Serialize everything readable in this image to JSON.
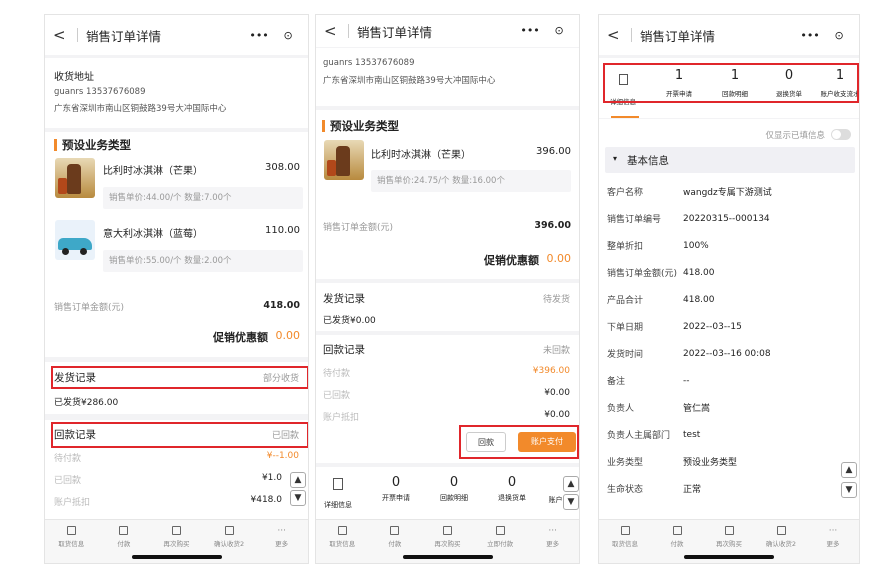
{
  "nav": {
    "back_glyph": "<",
    "title": "销售订单详情",
    "more_glyph": "•••",
    "close_glyph": "⊙"
  },
  "tabbar": [
    {
      "label": "取货信息"
    },
    {
      "label": "付款"
    },
    {
      "label": "再次购买"
    },
    {
      "label": "确认收货2"
    },
    {
      "label": "更多",
      "glyph": "···"
    }
  ],
  "tabbar2": [
    {
      "label": "取货信息"
    },
    {
      "label": "付款"
    },
    {
      "label": "再次购买"
    },
    {
      "label": "立即付款"
    },
    {
      "label": "更多",
      "glyph": "···"
    }
  ],
  "screen1": {
    "address_title": "收货地址",
    "contact": "guanrs  13537676089",
    "address": "广东省深圳市南山区铜鼓路39号大冲国际中心",
    "section_title": "预设业务类型",
    "products": [
      {
        "name": "比利时冰淇淋（芒果）",
        "price": "308.00",
        "sub": "销售单价:44.00/个   数量:7.00个"
      },
      {
        "name": "意大利冰淇淋（蓝莓）",
        "price": "110.00",
        "sub": "销售单价:55.00/个   数量:2.00个"
      }
    ],
    "amount_label": "销售订单金额(元)",
    "amount": "418.00",
    "promo_label": "促销优惠额",
    "promo": "0.00",
    "ship_label": "发货记录",
    "ship_status": "部分收货",
    "shipped": "已发货¥286.00",
    "pay_label": "回款记录",
    "pay_status": "已回款",
    "pending_label": "待付款",
    "pending": "¥--1.00",
    "paid_label": "已回款",
    "paid": "¥1.0",
    "offset_label": "账户抵扣",
    "offset": "¥418.0"
  },
  "screen2": {
    "contact": "guanrs  13537676089",
    "address": "广东省深圳市南山区铜鼓路39号大冲国际中心",
    "section_title": "预设业务类型",
    "product": {
      "name": "比利时冰淇淋（芒果）",
      "price": "396.00",
      "sub": "销售单价:24.75/个   数量:16.00个"
    },
    "amount_label": "销售订单金额(元)",
    "amount": "396.00",
    "promo_label": "促销优惠额",
    "promo": "0.00",
    "ship_label": "发货记录",
    "ship_status": "待发货",
    "shipped": "已发货¥0.00",
    "pay_label": "回款记录",
    "pay_status": "未回款",
    "pending_label": "待付款",
    "pending": "¥396.00",
    "paid_label": "已回款",
    "paid": "¥0.00",
    "offset_label": "账户抵扣",
    "offset": "¥0.00",
    "btn_pay": "回款",
    "btn_account": "账户支付",
    "stats": [
      {
        "num": "",
        "label": "详细信息"
      },
      {
        "num": "0",
        "label": "开票申请"
      },
      {
        "num": "0",
        "label": "回款明细"
      },
      {
        "num": "0",
        "label": "退换货单"
      },
      {
        "num": "",
        "label": "账户收"
      }
    ]
  },
  "screen3": {
    "stats": [
      {
        "num": "",
        "label": "详细信息"
      },
      {
        "num": "1",
        "label": "开票申请"
      },
      {
        "num": "1",
        "label": "回款明细"
      },
      {
        "num": "0",
        "label": "退换货单"
      },
      {
        "num": "1",
        "label": "账户收支流水"
      }
    ],
    "toggle_label": "仅显示已填信息",
    "group_title": "基本信息",
    "rows": [
      {
        "k": "客户名称",
        "v": "wangdz专属下游测试"
      },
      {
        "k": "销售订单编号",
        "v": "20220315--000134"
      },
      {
        "k": "整单折扣",
        "v": "100%"
      },
      {
        "k": "销售订单金额(元)",
        "v": "418.00"
      },
      {
        "k": "产品合计",
        "v": "418.00"
      },
      {
        "k": "下单日期",
        "v": "2022--03--15"
      },
      {
        "k": "发货时间",
        "v": "2022--03--16 00:08"
      },
      {
        "k": "备注",
        "v": "--"
      },
      {
        "k": "负责人",
        "v": "管仁嵩"
      },
      {
        "k": "负责人主属部门",
        "v": "test"
      },
      {
        "k": "业务类型",
        "v": "预设业务类型"
      },
      {
        "k": "生命状态",
        "v": "正常"
      }
    ]
  },
  "colors": {
    "accent": "#f28a2b",
    "highlight": "#e0262b",
    "link": "#3d6fd6",
    "amount": "#e0533c"
  }
}
